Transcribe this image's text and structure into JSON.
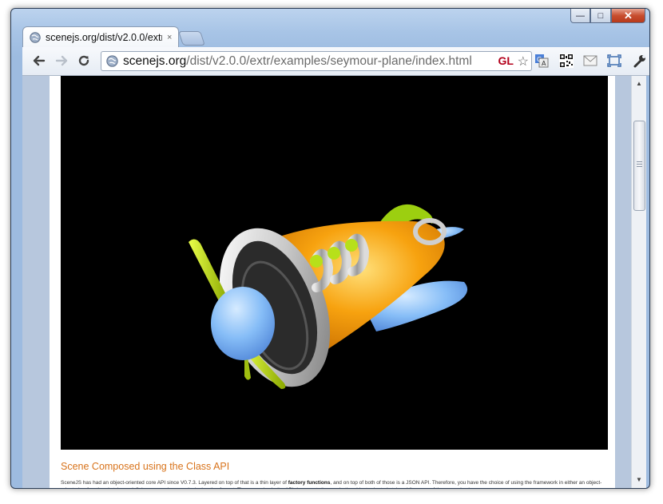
{
  "window": {
    "minimize_label": "—",
    "maximize_label": "□",
    "close_label": "✕"
  },
  "tab": {
    "title": "scenejs.org/dist/v2.0.0/extr/",
    "close_label": "×",
    "icon": "globe-icon"
  },
  "toolbar": {
    "url_host": "scenejs.org",
    "url_path": "/dist/v2.0.0/extr/examples/seymour-plane/index.html",
    "gl_badge": "GL",
    "icons": [
      "back-arrow-icon",
      "forward-arrow-icon",
      "reload-icon",
      "star-icon",
      "translate-icon",
      "qr-code-icon",
      "mail-icon",
      "fullscreen-icon",
      "wrench-icon"
    ]
  },
  "content": {
    "heading": "Scene Composed using the Class API",
    "paragraph_pre": "SceneJS has had an object-oriented core API since V0.7.3. Layered on top of that is a thin layer of ",
    "paragraph_bold": "factory functions",
    "paragraph_post": ", and on top of both of those is a JSON API. Therefore, you have the choice of using the framework in either an object-oriented or functional style, or defining scenes in a purely declarative format. The examples in the API documentation are in the object-oriented style, while many of the examples here"
  },
  "colors": {
    "accent_heading": "#d8731b",
    "gl_badge": "#b3001b",
    "canvas_bg": "#000000",
    "plane_body": "#f7a20f",
    "plane_wing": "#7fb4f5",
    "propeller": "#c6e600"
  }
}
